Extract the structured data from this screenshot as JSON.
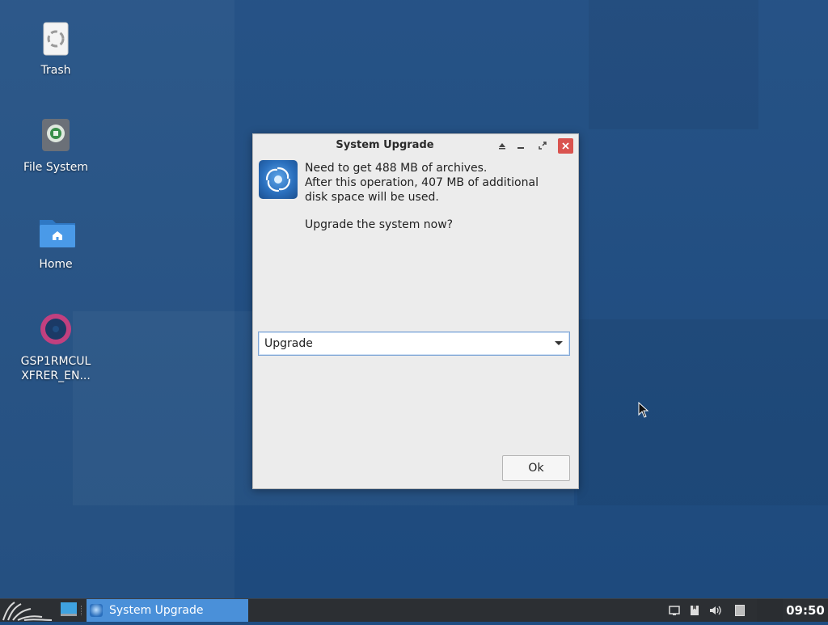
{
  "desktop": {
    "icons": [
      {
        "label": "Trash",
        "icon": "trash-icon"
      },
      {
        "label": "File System",
        "icon": "drive-icon"
      },
      {
        "label": "Home",
        "icon": "home-folder-icon"
      },
      {
        "label": "GSP1RMCUL\nXFRER_EN...",
        "icon": "disc-icon"
      }
    ]
  },
  "dialog": {
    "title": "System Upgrade",
    "message_lines": [
      "Need to get 488 MB of archives.",
      "After this operation, 407 MB of additional",
      "disk space will be used."
    ],
    "question": "Upgrade the system now?",
    "select_value": "Upgrade",
    "ok_label": "Ok"
  },
  "taskbar": {
    "task_label": "System Upgrade",
    "clock": "09:50"
  },
  "colors": {
    "desktop_bg": "#1f4d82",
    "accent": "#4a90d9",
    "close": "#d9534f",
    "taskbar": "#2c2f33"
  }
}
